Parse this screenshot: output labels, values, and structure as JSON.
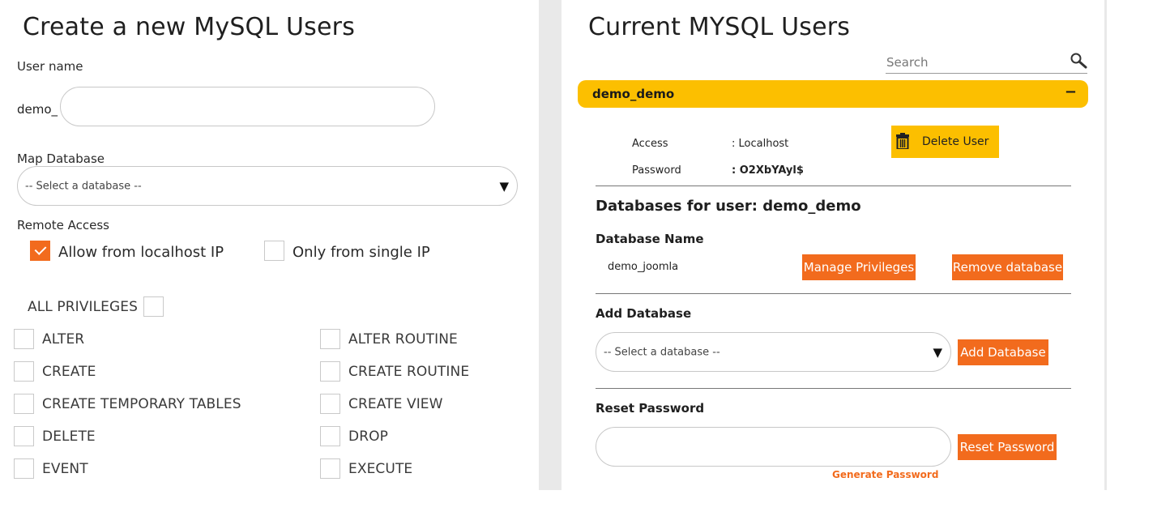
{
  "left": {
    "title": "Create a new MySQL Users",
    "username_label": "User name",
    "username_prefix": "demo_",
    "username_value": "",
    "map_db_label": "Map Database",
    "map_db_selected": "-- Select a database --",
    "remote_access_label": "Remote Access",
    "remote_options": [
      {
        "label": "Allow from localhost IP",
        "checked": true
      },
      {
        "label": "Only from single IP",
        "checked": false
      }
    ],
    "all_privileges_label": "ALL PRIVILEGES",
    "all_privileges_checked": false,
    "privileges_left": [
      "ALTER",
      "CREATE",
      "CREATE TEMPORARY TABLES",
      "DELETE",
      "EVENT"
    ],
    "privileges_right": [
      "ALTER ROUTINE",
      "CREATE ROUTINE",
      "CREATE VIEW",
      "DROP",
      "EXECUTE"
    ]
  },
  "right": {
    "title": "Current MYSQL Users",
    "search_placeholder": "Search",
    "user": {
      "name": "demo_demo",
      "toggle": "−",
      "access_label": "Access",
      "access_value": ": Localhost",
      "password_label": "Password",
      "password_value": ": O2XbYAyl$",
      "delete_label": "Delete User"
    },
    "databases_heading": "Databases for user: demo_demo",
    "db_name_header": "Database Name",
    "databases": [
      {
        "name": "demo_joomla",
        "manage_label": "Manage Privileges",
        "remove_label": "Remove database"
      }
    ],
    "add_db_heading": "Add Database",
    "add_db_selected": "-- Select a database --",
    "add_db_button": "Add Database",
    "reset_heading": "Reset Password",
    "reset_value": "",
    "reset_button": "Reset Password",
    "generate_label": "Generate Password"
  },
  "colors": {
    "accent_orange": "#f26b1d",
    "accent_yellow": "#fcbf00",
    "background_gutter": "#e9e9e9"
  }
}
